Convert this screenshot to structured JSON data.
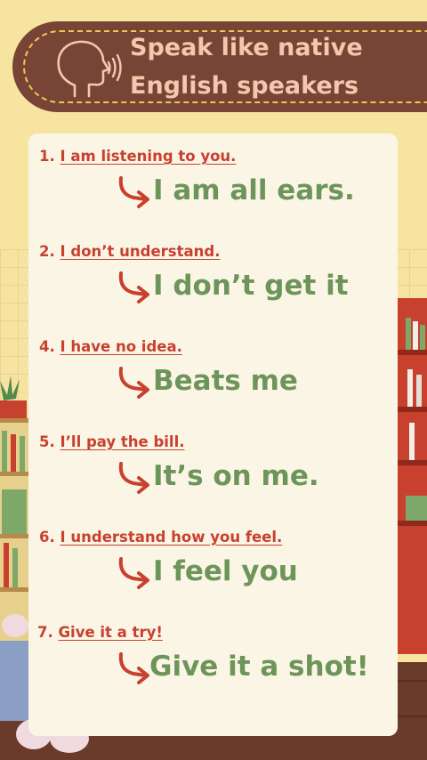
{
  "header": {
    "title_line1": "Speak like native",
    "title_line2": "English speakers",
    "icon": "speaking-head-icon"
  },
  "phrases": [
    {
      "number": "1.",
      "text": "I am listening to you.",
      "native": "I am all ears."
    },
    {
      "number": "2.",
      "text": "I don’t understand.",
      "native": "I don’t get it"
    },
    {
      "number": "4.",
      "text": "I have no idea.",
      "native": "Beats me"
    },
    {
      "number": "5.",
      "text": "I’ll pay the bill.",
      "native": "It’s on me."
    },
    {
      "number": "6.",
      "text": "I understand how you feel.",
      "native": "I feel you"
    },
    {
      "number": "7.",
      "text": "Give it a try!",
      "native": "Give it a shot!"
    }
  ],
  "colors": {
    "banner": "#774436",
    "banner_text": "#f6c6ad",
    "accent_red": "#c8412f",
    "native_green": "#6d955a",
    "card": "#fbf5e6",
    "background": "#f7e4a0"
  }
}
